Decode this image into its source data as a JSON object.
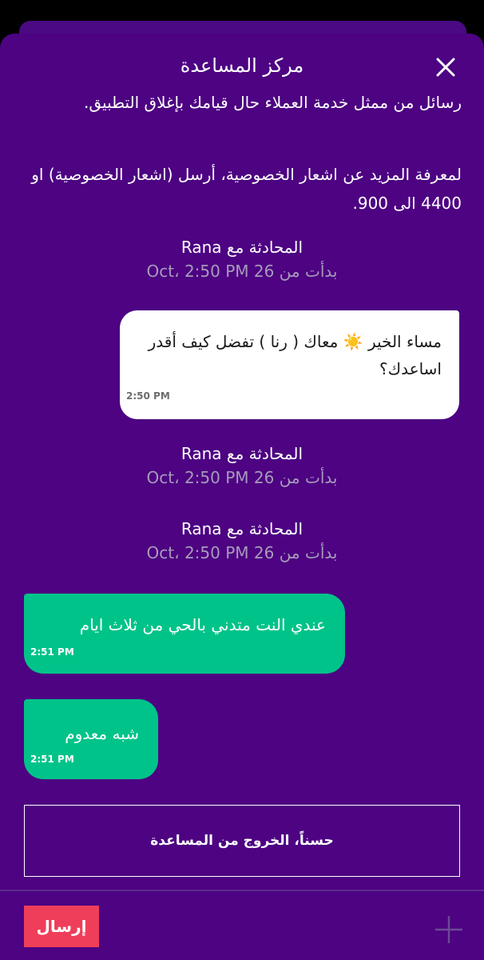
{
  "header": {
    "title": "مركز المساعدة",
    "close_icon": "close-icon"
  },
  "messages_area": {
    "cut_text_line": "رسائل من ممثل خدمة العملاء حال قيامك بإغلاق التطبيق.",
    "privacy_info": "لمعرفة المزيد عن اشعار الخصوصية، أرسل (اشعار الخصوصية) او 4400 الى 900."
  },
  "conversation_markers": [
    {
      "title": "المحادثة مع Rana",
      "started": "بدأت من 26 Oct، 2:50 PM"
    },
    {
      "title": "المحادثة مع Rana",
      "started": "بدأت من 26 Oct، 2:50 PM"
    },
    {
      "title": "المحادثة مع Rana",
      "started": "بدأت من 26 Oct، 2:50 PM"
    }
  ],
  "agent_message": {
    "text": "مساء الخير ☀️ معاك ( رنا ) تفضل كيف أقدر اساعدك؟",
    "time": "2:50 PM"
  },
  "user_messages": [
    {
      "text": "عندي النت متدني بالحي من ثلاث ايام",
      "time": "2:51 PM"
    },
    {
      "text": "شبه معدوم",
      "time": "2:51 PM"
    }
  ],
  "exit_button_label": "حسناً، الخروج من المساعدة",
  "composer": {
    "send_label": "إرسال",
    "add_icon": "plus-icon"
  },
  "colors": {
    "background": "#4d0382",
    "user_bubble": "#00c389",
    "agent_bubble": "#ffffff",
    "send_button": "#ef3e59"
  }
}
